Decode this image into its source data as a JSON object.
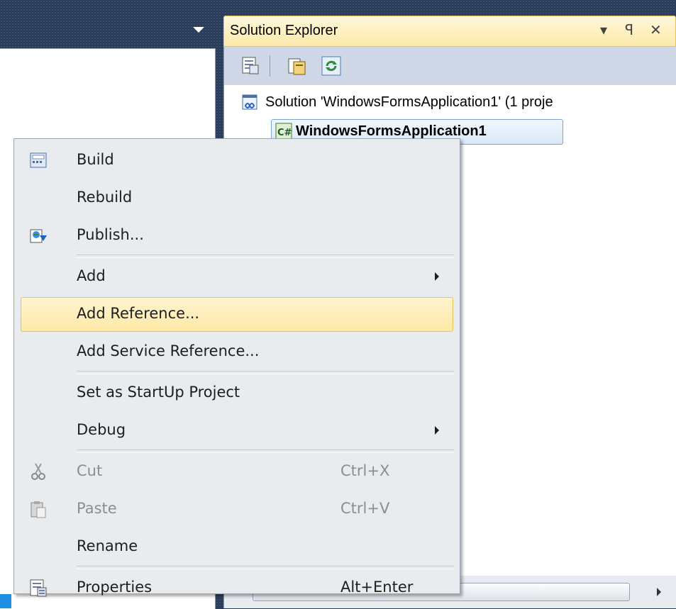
{
  "solution_explorer": {
    "title": "Solution Explorer",
    "buttons": {
      "dropdown": "▾",
      "pin": "ꟼ",
      "close": "✕"
    },
    "tree": {
      "solution_label": "Solution 'WindowsFormsApplication1' (1 proje",
      "project_label": "WindowsFormsApplication1"
    }
  },
  "context_menu": {
    "items": [
      {
        "label": "Build",
        "icon": "build-icon"
      },
      {
        "label": "Rebuild"
      },
      {
        "label": "Publish...",
        "icon": "publish-icon"
      },
      {
        "separator": true
      },
      {
        "label": "Add",
        "submenu": true
      },
      {
        "label": "Add Reference...",
        "highlighted": true
      },
      {
        "label": "Add Service Reference..."
      },
      {
        "separator": true
      },
      {
        "label": "Set as StartUp Project"
      },
      {
        "label": "Debug",
        "submenu": true
      },
      {
        "separator": true
      },
      {
        "label": "Cut",
        "shortcut": "Ctrl+X",
        "disabled": true,
        "icon": "scissors-icon"
      },
      {
        "label": "Paste",
        "shortcut": "Ctrl+V",
        "disabled": true,
        "icon": "paste-icon"
      },
      {
        "label": "Rename"
      },
      {
        "separator": true
      },
      {
        "label": "Properties",
        "shortcut": "Alt+Enter",
        "icon": "properties-icon"
      }
    ]
  },
  "colors": {
    "background": "#293955",
    "title_bar": "#fce9a8",
    "highlight": "#fde9a7",
    "menu_bg": "#e9ecee"
  }
}
